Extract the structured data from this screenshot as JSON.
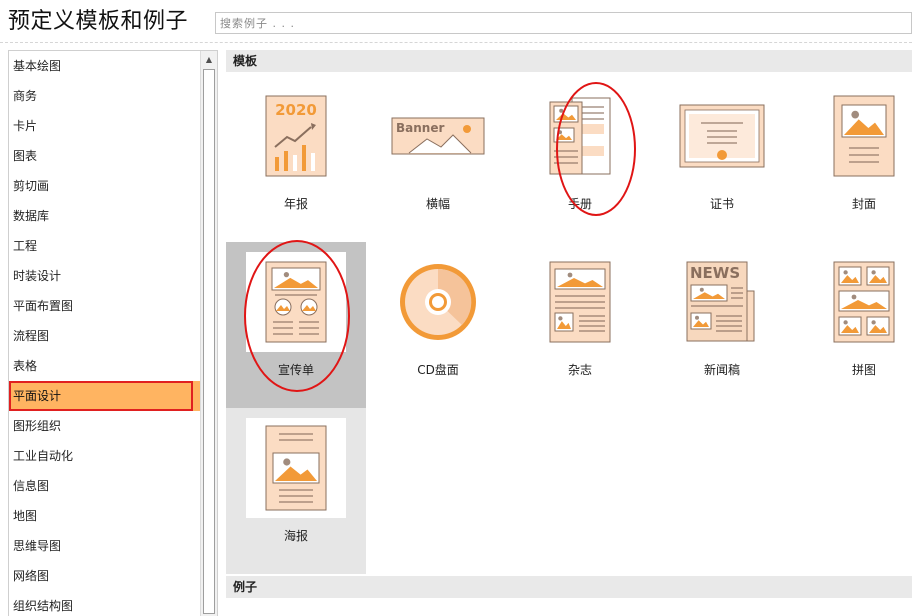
{
  "header": {
    "title": "预定义模板和例子",
    "search_placeholder": "搜索例子 . . ."
  },
  "sidebar": {
    "active_index": 11,
    "items": [
      {
        "label": "基本绘图"
      },
      {
        "label": "商务"
      },
      {
        "label": "卡片"
      },
      {
        "label": "图表"
      },
      {
        "label": "剪切画"
      },
      {
        "label": "数据库"
      },
      {
        "label": "工程"
      },
      {
        "label": "时装设计"
      },
      {
        "label": "平面布置图"
      },
      {
        "label": "流程图"
      },
      {
        "label": "表格"
      },
      {
        "label": "平面设计"
      },
      {
        "label": "图形组织"
      },
      {
        "label": "工业自动化"
      },
      {
        "label": "信息图"
      },
      {
        "label": "地图"
      },
      {
        "label": "思维导图"
      },
      {
        "label": "网络图"
      },
      {
        "label": "组织结构图"
      }
    ]
  },
  "main": {
    "templates_header": "模板",
    "examples_header": "例子",
    "templates": [
      {
        "label": "年报",
        "icon": "annual-report-icon",
        "thumb_text": "2020"
      },
      {
        "label": "横幅",
        "icon": "banner-icon",
        "thumb_text": "Banner"
      },
      {
        "label": "手册",
        "icon": "brochure-icon",
        "circled": true
      },
      {
        "label": "证书",
        "icon": "certificate-icon"
      },
      {
        "label": "封面",
        "icon": "cover-icon"
      },
      {
        "label": "宣传单",
        "icon": "flyer-icon",
        "selected": true,
        "circled": true
      },
      {
        "label": "CD盘面",
        "icon": "cd-icon"
      },
      {
        "label": "杂志",
        "icon": "magazine-icon"
      },
      {
        "label": "新闻稿",
        "icon": "newsletter-icon",
        "thumb_text": "NEWS"
      },
      {
        "label": "拼图",
        "icon": "collage-icon"
      },
      {
        "label": "海报",
        "icon": "poster-icon",
        "hover": true
      }
    ]
  },
  "colors": {
    "accent_orange": "#ffb461",
    "thumb_fill": "#fbdcc3",
    "thumb_stroke": "#8a6f5e",
    "icon_orange": "#f29a38",
    "highlight_red": "#e01515",
    "selected_bg": "#c3c3c3"
  }
}
